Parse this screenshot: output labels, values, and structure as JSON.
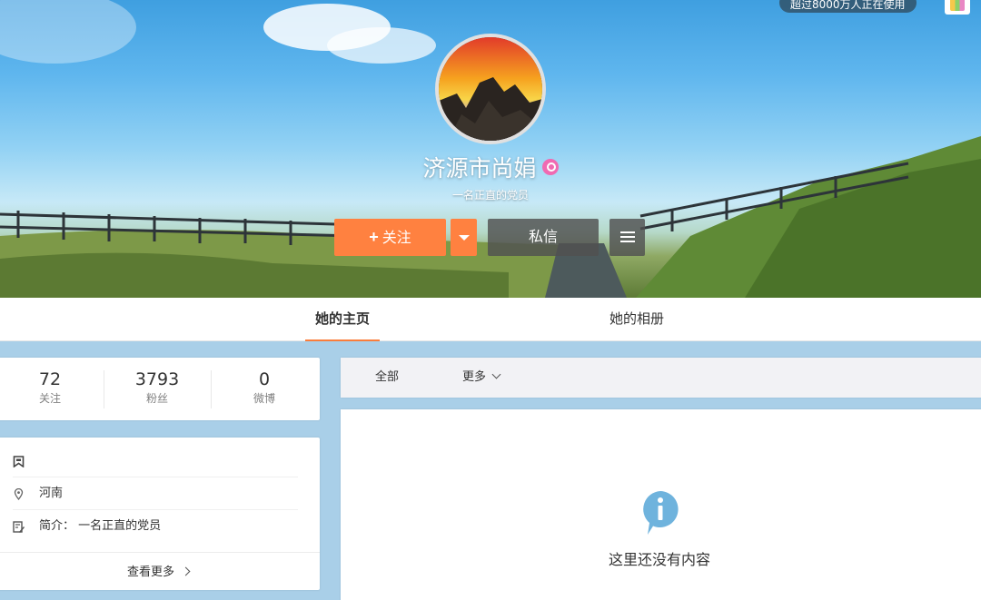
{
  "banner": {
    "top_badge": "超过8000万人正在使用"
  },
  "profile": {
    "name": "济源市尚娟",
    "motto": "一名正直的党员",
    "follow_label": "关注",
    "message_label": "私信"
  },
  "tabs": [
    {
      "label": "她的主页",
      "active": true
    },
    {
      "label": "她的相册",
      "active": false
    }
  ],
  "stats": [
    {
      "value": "72",
      "label": "关注"
    },
    {
      "value": "3793",
      "label": "粉丝"
    },
    {
      "value": "0",
      "label": "微博"
    }
  ],
  "info": {
    "location": "河南",
    "bio_label": "简介：",
    "bio": "一名正直的党员",
    "more_label": "查看更多"
  },
  "feed": {
    "filters": [
      {
        "label": "全部"
      },
      {
        "label": "更多"
      }
    ],
    "empty_text": "这里还没有内容"
  },
  "colors": {
    "accent": "#ff8140",
    "tab_underline": "#fa7d3c",
    "info_icon": "#6fb3dd"
  }
}
